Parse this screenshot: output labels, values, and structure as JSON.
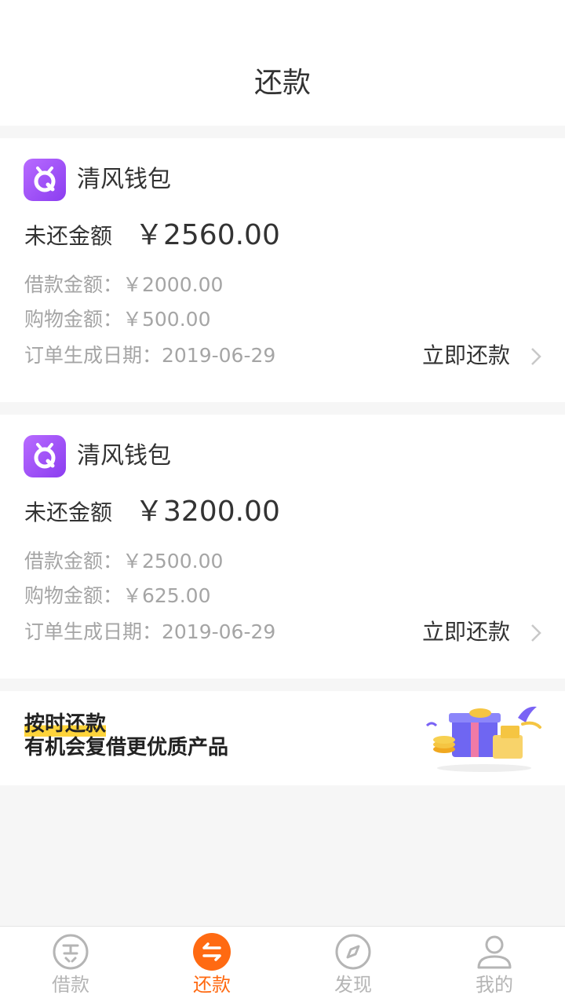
{
  "header": {
    "title": "还款"
  },
  "loans": [
    {
      "app_name": "清风钱包",
      "outstanding_label": "未还金额",
      "outstanding_value": "￥2560.00",
      "loan_amount": "借款金额：￥2000.00",
      "shopping_amount": "购物金额：￥500.00",
      "order_date": "订单生成日期：2019-06-29",
      "action_label": "立即还款"
    },
    {
      "app_name": "清风钱包",
      "outstanding_label": "未还金额",
      "outstanding_value": "￥3200.00",
      "loan_amount": "借款金额：￥2500.00",
      "shopping_amount": "购物金额：￥625.00",
      "order_date": "订单生成日期：2019-06-29",
      "action_label": "立即还款"
    }
  ],
  "promo": {
    "line1": "按时还款",
    "line2": "有机会复借更优质产品",
    "image_icon": "gift-box-coins-icon"
  },
  "tabbar": {
    "active_color": "#ff6a12",
    "items": [
      {
        "label": "借款",
        "icon": "loan-icon"
      },
      {
        "label": "还款",
        "icon": "repay-icon"
      },
      {
        "label": "发现",
        "icon": "compass-icon"
      },
      {
        "label": "我的",
        "icon": "user-icon"
      }
    ]
  }
}
